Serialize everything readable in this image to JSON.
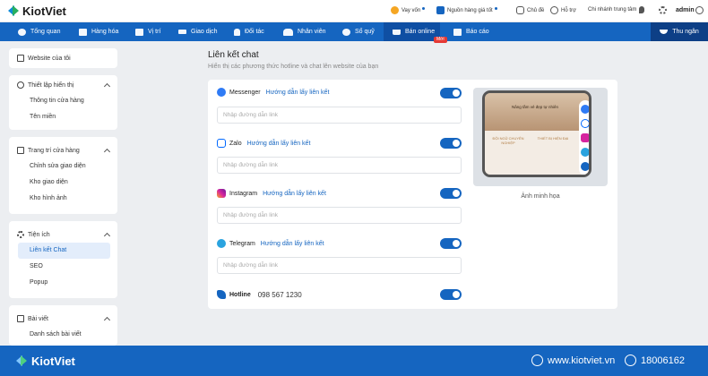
{
  "brand": {
    "name": "KiotViet"
  },
  "topbar": {
    "items": [
      {
        "label": "Vay vốn",
        "icon": "money-bag-icon"
      },
      {
        "label": "Nguồn hàng giá tốt",
        "icon": "kiotviet-mark-icon"
      },
      {
        "label": "Chủ đề",
        "icon": "chat-bubble-icon"
      },
      {
        "label": "Hỗ trợ",
        "icon": "headset-icon"
      },
      {
        "label": "Chi nhánh trung tâm",
        "icon": "location-pin-icon"
      }
    ],
    "user": "admin",
    "settings_icon": "gear-icon",
    "avatar_icon": "user-icon"
  },
  "navbar": {
    "items": [
      {
        "label": "Tổng quan",
        "icon": "eye-icon"
      },
      {
        "label": "Hàng hóa",
        "icon": "box-icon"
      },
      {
        "label": "Vị trí",
        "icon": "grid-icon"
      },
      {
        "label": "Giao dịch",
        "icon": "swap-icon"
      },
      {
        "label": "Đối tác",
        "icon": "person-icon"
      },
      {
        "label": "Nhân viên",
        "icon": "people-icon"
      },
      {
        "label": "Sổ quỹ",
        "icon": "coin-icon"
      },
      {
        "label": "Bán online",
        "icon": "cart-icon",
        "active": true
      },
      {
        "label": "Báo cáo",
        "icon": "chart-icon"
      }
    ],
    "badge": "Mới",
    "cashier": {
      "label": "Thu ngân",
      "icon": "bowl-icon"
    }
  },
  "sidebar": {
    "website": "Website của tôi",
    "sections": [
      {
        "title": "Thiết lập hiển thị",
        "items": [
          "Thông tin cửa hàng",
          "Tên miền"
        ]
      },
      {
        "title": "Trang trí cửa hàng",
        "items": [
          "Chỉnh sửa giao diện",
          "Kho giao diện",
          "Kho hình ảnh"
        ]
      },
      {
        "title": "Tiện ích",
        "items": [
          "Liên kết Chat",
          "SEO",
          "Popup"
        ]
      },
      {
        "title": "Bài viết",
        "items": [
          "Danh sách bài viết"
        ]
      }
    ]
  },
  "main": {
    "title": "Liên kết chat",
    "subtitle": "Hiển thị các phương thức hotline và chat lên website của bạn",
    "channels": [
      {
        "name": "Messenger",
        "link": "Hướng dẫn lấy liên kết",
        "placeholder": "Nhập đường dẫn link",
        "enabled": true,
        "color": "#2f7bf5"
      },
      {
        "name": "Zalo",
        "link": "Hướng dẫn lấy liên kết",
        "placeholder": "Nhập đường dẫn link",
        "enabled": true,
        "color": "#0068ff"
      },
      {
        "name": "Instagram",
        "link": "Hướng dẫn lấy liên kết",
        "placeholder": "Nhập đường dẫn link",
        "enabled": true,
        "color": "#d6249f"
      },
      {
        "name": "Telegram",
        "link": "Hướng dẫn lấy liên kết",
        "placeholder": "Nhập đường dẫn link",
        "enabled": true,
        "color": "#2aa3df"
      }
    ],
    "hotline": {
      "name": "Hotline",
      "value": "098 567 1230",
      "enabled": true
    },
    "preview_caption": "Ảnh minh họa",
    "preview_text": {
      "headline": "Nâng tầm vẻ đẹp tự nhiên",
      "col1": "ĐỘI NGŨ CHUYÊN NGHIỆP",
      "col2": "THIẾT BỊ HIỆN ĐẠI"
    }
  },
  "footer": {
    "brand": "KiotViet",
    "website": "www.kiotviet.vn",
    "phone": "18006162"
  }
}
